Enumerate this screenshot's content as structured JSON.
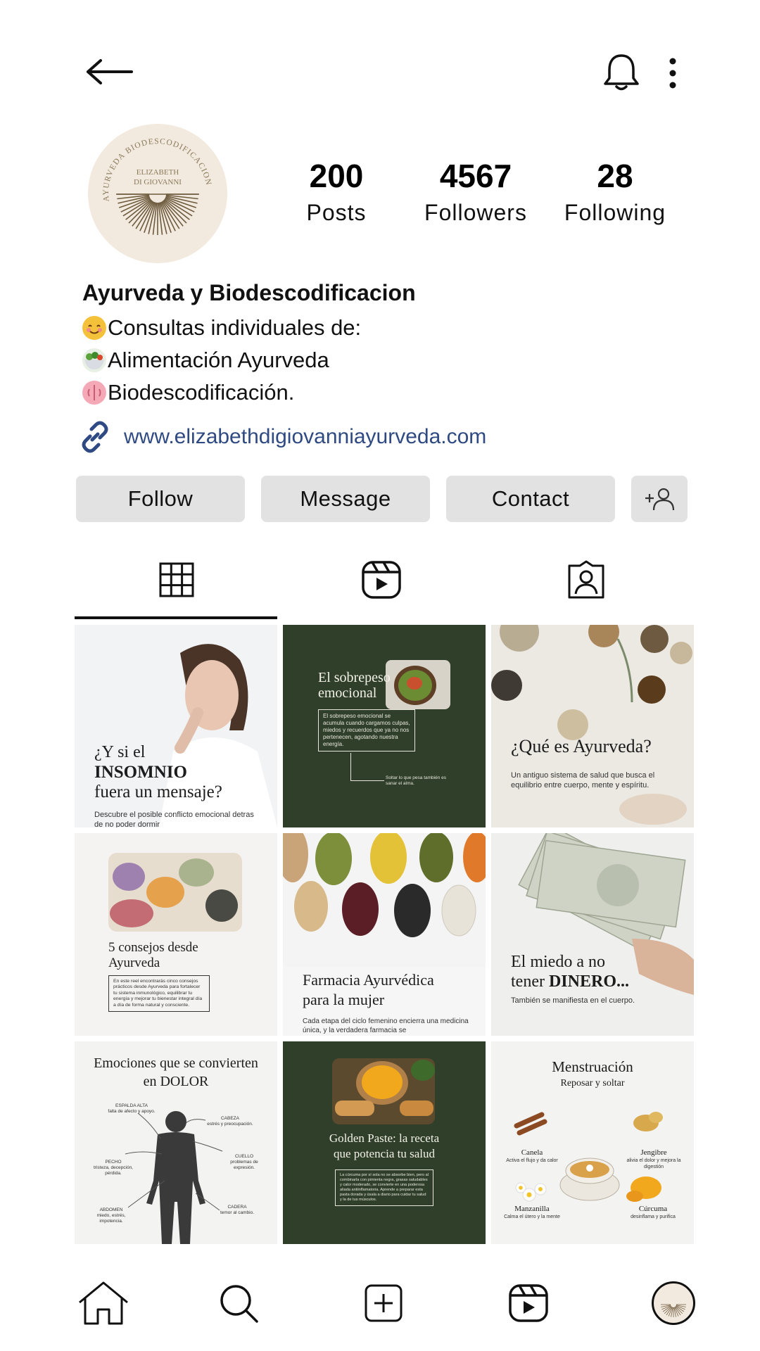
{
  "profile": {
    "name": "Ayurveda y Biodescodificacion",
    "avatar_text_arc": "AYURVEDA BIODESCODIFICACION",
    "avatar_name_line1": "ELIZABETH",
    "avatar_name_line2": "DI GIOVANNI",
    "bio": [
      "Consultas individuales de:",
      "Alimentación Ayurveda",
      "Biodescodificación."
    ],
    "link": "www.elizabethdigiovanniayurveda.com"
  },
  "stats": {
    "posts": {
      "value": "200",
      "label": "Posts"
    },
    "followers": {
      "value": "4567",
      "label": "Followers"
    },
    "following": {
      "value": "28",
      "label": "Following"
    }
  },
  "actions": {
    "follow": "Follow",
    "message": "Message",
    "contact": "Contact"
  },
  "posts": {
    "p1": {
      "line1": "¿Y si el",
      "line2": "INSOMNIO",
      "line3": "fuera un mensaje?",
      "sub": "Descubre el posible conflicto emocional detras de no poder dormir"
    },
    "p2": {
      "title1": "El sobrepeso",
      "title2": "emocional",
      "box": "El sobrepeso emocional se acumula cuando cargamos culpas, miedos y recuerdos que ya no nos pertenecen, agotando nuestra energía.",
      "note": "Soltar lo que pesa también es sanar el alma."
    },
    "p3": {
      "title": "¿Qué es Ayurveda?",
      "sub": "Un antiguo sistema de salud que busca el equilibrio entre cuerpo, mente y espíritu."
    },
    "p4": {
      "title1": "5 consejos desde",
      "title2": "Ayurveda",
      "box": "En este reel encontrarás cinco consejos prácticos desde Ayurveda para fortalecer tu sistema inmunológico, equilibrar tu energía y mejorar tu bienestar integral día a día de forma natural y consciente."
    },
    "p5": {
      "title1": "Farmacia Ayurvédica",
      "title2": "para la mujer",
      "sub": "Cada etapa del ciclo femenino encierra una medicina única, y la verdadera farmacia se"
    },
    "p6": {
      "line1": "El miedo a no",
      "line2a": "tener ",
      "line2b": "DINERO...",
      "sub": "También se manifiesta en el cuerpo."
    },
    "p7": {
      "title1": "Emociones que se convierten",
      "title2": "en DOLOR",
      "labels": [
        {
          "h": "ESPALDA ALTA",
          "t": "falta de afecto y apoyo."
        },
        {
          "h": "CABEZA",
          "t": "estrés y preocupación."
        },
        {
          "h": "PECHO",
          "t": "tristeza, decepción, pérdida."
        },
        {
          "h": "CUELLO",
          "t": "problemas de expresión."
        },
        {
          "h": "ABDOMEN",
          "t": "miedo, estrés, impotencia."
        },
        {
          "h": "CADERA",
          "t": "temor al cambio."
        }
      ]
    },
    "p8": {
      "title1": "Golden Paste: la receta",
      "title2": "que potencia tu salud",
      "box": "La cúrcuma por sí sola no se absorbe bien, pero al combinarla con pimienta negra, grasas saludables y calor moderado, se convierte en una poderosa aliada antiinflamatoria. Aprende a preparar esta pasta dorada y úsala a diario para cuidar tu salud y la de tus músculos."
    },
    "p9": {
      "title": "Menstruación",
      "sub": "Reposar y soltar",
      "items": [
        {
          "h": "Canela",
          "t": "Activa el flujo y da calor"
        },
        {
          "h": "Jengibre",
          "t": "alivia el dolor y mejora la digestión"
        },
        {
          "h": "Manzanilla",
          "t": "Calma el útero y la mente"
        },
        {
          "h": "Cúrcuma",
          "t": "desinflama y purifica"
        }
      ]
    }
  },
  "colors": {
    "dark_green": "#2f3f2a",
    "link_blue": "#2f4a82",
    "button_gray": "#e2e2e2"
  },
  "icons": [
    "back-arrow-icon",
    "bell-icon",
    "more-vertical-icon",
    "link-icon",
    "add-person-icon",
    "grid-icon",
    "reels-icon",
    "tagged-icon",
    "home-icon",
    "search-icon",
    "create-icon"
  ]
}
